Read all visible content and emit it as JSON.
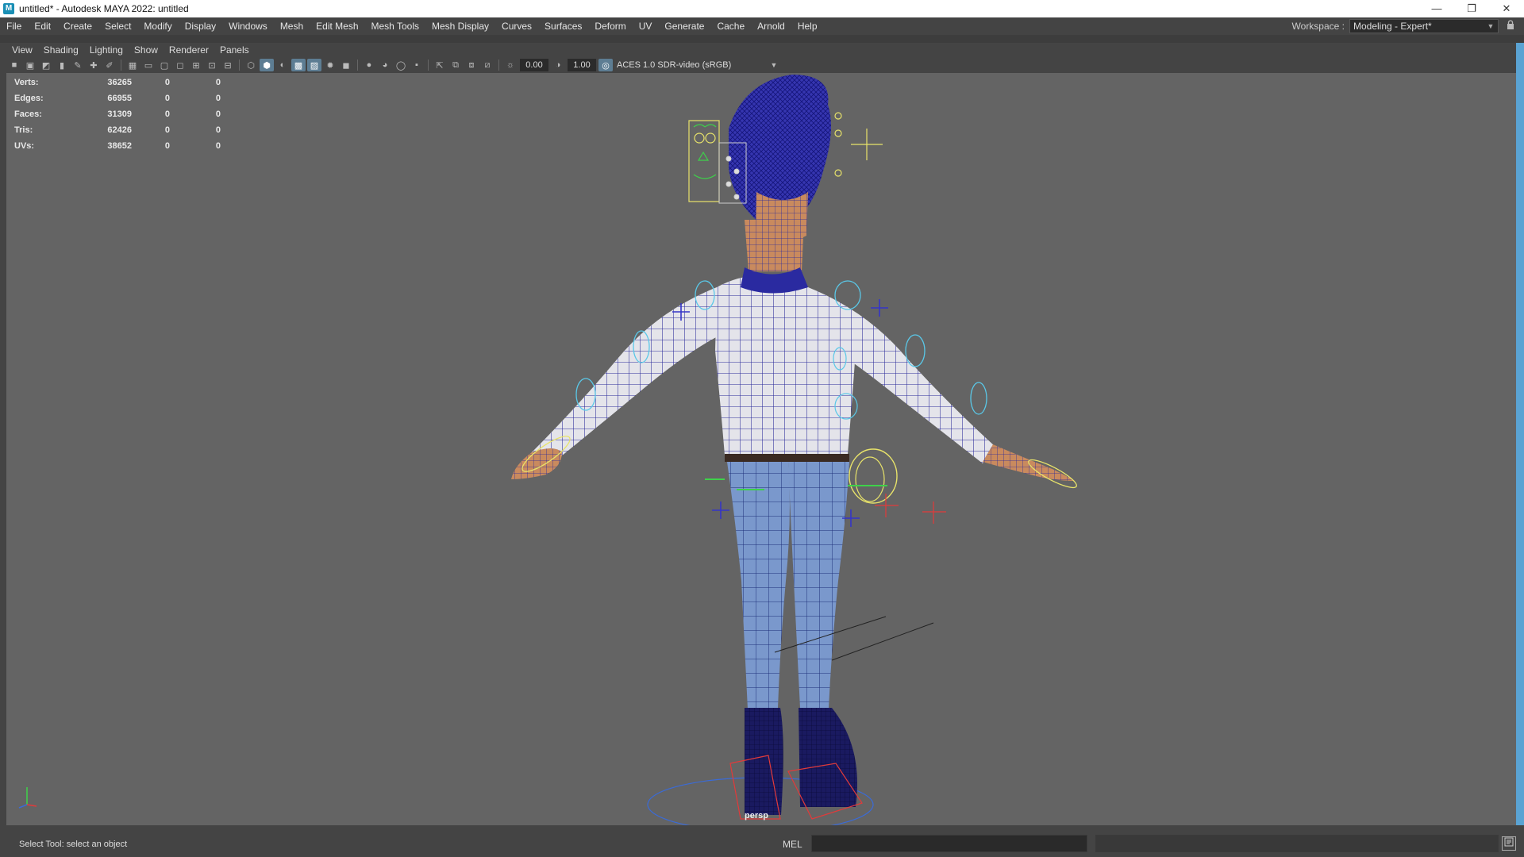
{
  "window": {
    "title": "untitled* - Autodesk MAYA 2022: untitled",
    "app_icon": "M",
    "minimize_glyph": "—",
    "restore_glyph": "❐",
    "close_glyph": "✕"
  },
  "menubar": {
    "items": [
      "File",
      "Edit",
      "Create",
      "Select",
      "Modify",
      "Display",
      "Windows",
      "Mesh",
      "Edit Mesh",
      "Mesh Tools",
      "Mesh Display",
      "Curves",
      "Surfaces",
      "Deform",
      "UV",
      "Generate",
      "Cache",
      "Arnold",
      "Help"
    ]
  },
  "workspace": {
    "label": "Workspace :",
    "value": "Modeling - Expert*",
    "arrow": "▼",
    "lock_icon": "🔒"
  },
  "panel_menu": {
    "items": [
      "View",
      "Shading",
      "Lighting",
      "Show",
      "Renderer",
      "Panels"
    ]
  },
  "panel_toolbar": {
    "near_clip": "0.00",
    "far_clip": "1.00",
    "color_space": "ACES 1.0 SDR-video (sRGB)",
    "dropdown_arrow": "▼"
  },
  "hud": {
    "rows": [
      {
        "label": "Verts:",
        "value": "36265",
        "z1": "0",
        "z2": "0"
      },
      {
        "label": "Edges:",
        "value": "66955",
        "z1": "0",
        "z2": "0"
      },
      {
        "label": "Faces:",
        "value": "31309",
        "z1": "0",
        "z2": "0"
      },
      {
        "label": "Tris:",
        "value": "62426",
        "z1": "0",
        "z2": "0"
      },
      {
        "label": "UVs:",
        "value": "38652",
        "z1": "0",
        "z2": "0"
      }
    ]
  },
  "viewport": {
    "camera_label": "persp"
  },
  "statusbar": {
    "message": "Select Tool: select an object",
    "language": "MEL",
    "command_value": ""
  },
  "colors": {
    "wire_blue": "#2a2a9a",
    "shirt_white": "#e6e6ea",
    "jeans_blue": "#6f8fc7",
    "skin": "#c98a5e",
    "ctrl_yellow": "#e8e36a",
    "ctrl_cyan": "#5ac8e8",
    "ctrl_red": "#e23a3a",
    "ctrl_green": "#3ed14a",
    "accent": "#5aa3d3"
  }
}
